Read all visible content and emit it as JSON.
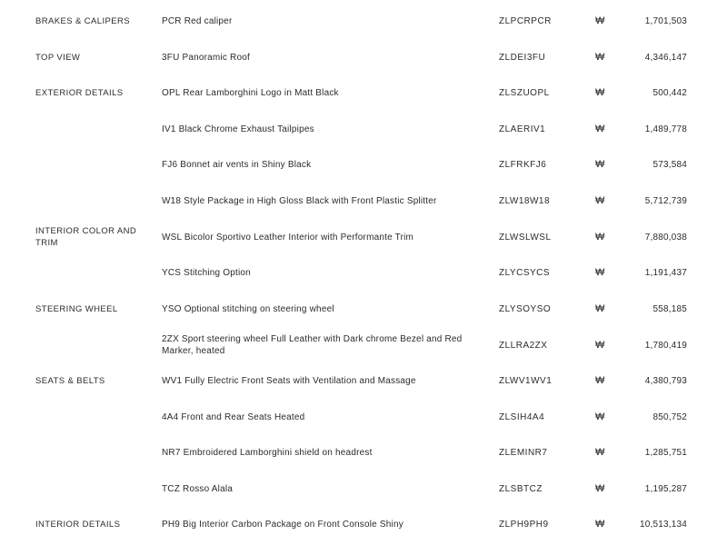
{
  "rows": [
    {
      "category": "BRAKES & CALIPERS",
      "description": "PCR Red caliper",
      "code": "ZLPCRPCR",
      "currency": "₩",
      "price": "1,701,503"
    },
    {
      "category": "TOP VIEW",
      "description": "3FU Panoramic Roof",
      "code": "ZLDEI3FU",
      "currency": "₩",
      "price": "4,346,147"
    },
    {
      "category": "EXTERIOR DETAILS",
      "description": "OPL Rear Lamborghini Logo in Matt Black",
      "code": "ZLSZUOPL",
      "currency": "₩",
      "price": "500,442"
    },
    {
      "category": "",
      "description": "IV1 Black Chrome Exhaust Tailpipes",
      "code": "ZLAERIV1",
      "currency": "₩",
      "price": "1,489,778"
    },
    {
      "category": "",
      "description": "FJ6 Bonnet air vents in Shiny Black",
      "code": "ZLFRKFJ6",
      "currency": "₩",
      "price": "573,584"
    },
    {
      "category": "",
      "description": "W18 Style Package in High Gloss Black with Front Plastic Splitter",
      "code": "ZLW18W18",
      "currency": "₩",
      "price": "5,712,739"
    },
    {
      "category": "INTERIOR COLOR AND TRIM",
      "description": "WSL Bicolor Sportivo Leather Interior with Performante Trim",
      "code": "ZLWSLWSL",
      "currency": "₩",
      "price": "7,880,038"
    },
    {
      "category": "",
      "description": "YCS Stitching Option",
      "code": "ZLYCSYCS",
      "currency": "₩",
      "price": "1,191,437"
    },
    {
      "category": "STEERING WHEEL",
      "description": "YSO Optional stitching on steering wheel",
      "code": "ZLYSOYSO",
      "currency": "₩",
      "price": "558,185"
    },
    {
      "category": "",
      "description": "2ZX Sport steering wheel Full Leather with Dark chrome Bezel and Red Marker, heated",
      "code": "ZLLRA2ZX",
      "currency": "₩",
      "price": "1,780,419"
    },
    {
      "category": "SEATS & BELTS",
      "description": "WV1 Fully Electric Front Seats with Ventilation and Massage",
      "code": "ZLWV1WV1",
      "currency": "₩",
      "price": "4,380,793"
    },
    {
      "category": "",
      "description": "4A4 Front and Rear Seats Heated",
      "code": "ZLSIH4A4",
      "currency": "₩",
      "price": "850,752"
    },
    {
      "category": "",
      "description": "NR7 Embroidered Lamborghini shield on headrest",
      "code": "ZLEMINR7",
      "currency": "₩",
      "price": "1,285,751"
    },
    {
      "category": "",
      "description": "TCZ Rosso Alala",
      "code": "ZLSBTCZ",
      "currency": "₩",
      "price": "1,195,287"
    },
    {
      "category": "INTERIOR DETAILS",
      "description": "PH9 Big Interior Carbon Package on Front Console Shiny",
      "code": "ZLPH9PH9",
      "currency": "₩",
      "price": "10,513,134"
    }
  ]
}
